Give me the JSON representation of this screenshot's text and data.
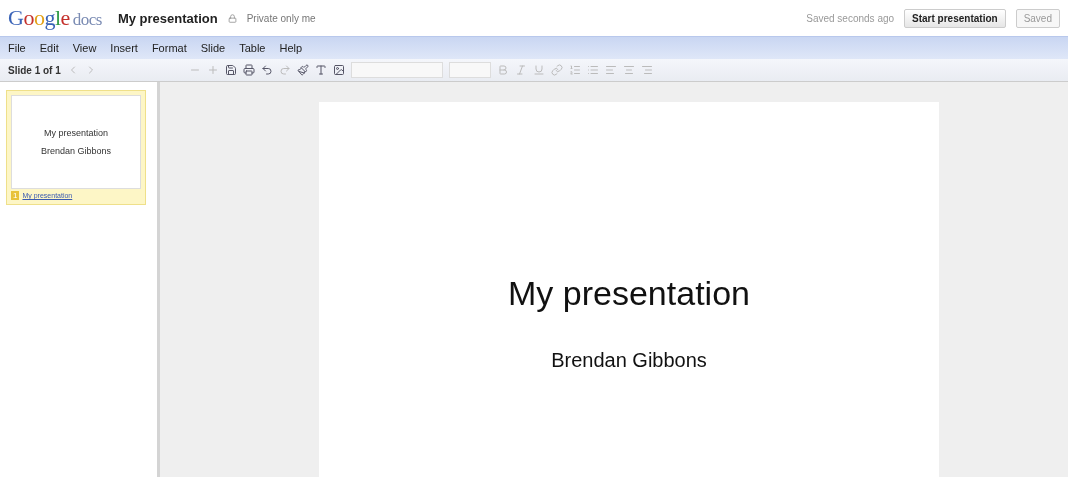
{
  "app": {
    "logo": "Google",
    "product": "docs"
  },
  "document": {
    "title": "My presentation",
    "sharing": "Private only me"
  },
  "status": "Saved seconds ago",
  "buttons": [
    {
      "label": "Start presentation",
      "kind": "primary"
    },
    {
      "label": "Saved",
      "kind": "disabled"
    }
  ],
  "menu": [
    "File",
    "Edit",
    "View",
    "Insert",
    "Format",
    "Slide",
    "Table",
    "Help"
  ],
  "toolbar": {
    "slide_counter": "Slide 1 of 1"
  },
  "thumbnails": [
    {
      "number": "1",
      "title": "My presentation",
      "subtitle": "Brendan Gibbons",
      "caption": "My presentation",
      "selected": true
    }
  ],
  "slide": {
    "title": "My presentation",
    "subtitle": "Brendan Gibbons"
  }
}
